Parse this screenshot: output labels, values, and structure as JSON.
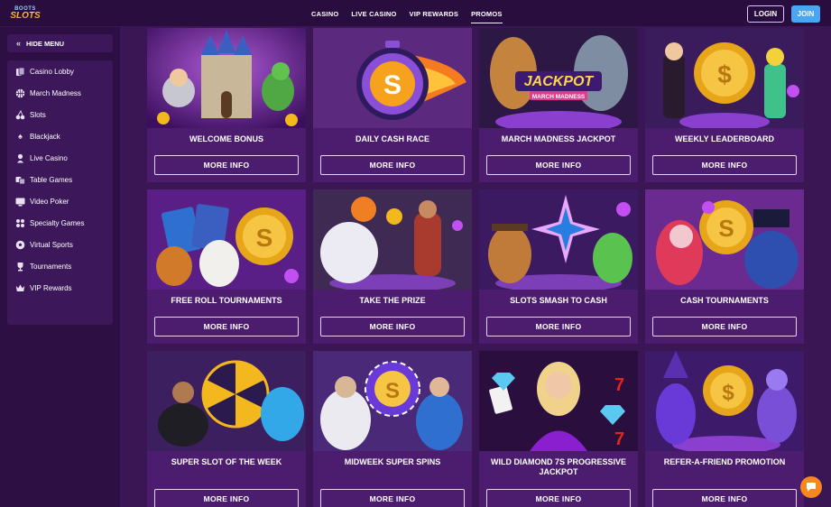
{
  "header": {
    "logo_top": "BOOTS",
    "logo_bottom": "SLOTS",
    "nav": [
      "CASINO",
      "LIVE CASINO",
      "VIP REWARDS",
      "PROMOS"
    ],
    "active_nav": "PROMOS",
    "login_label": "LOGIN",
    "join_label": "JOIN"
  },
  "sidebar": {
    "hide_menu_label": "HIDE MENU",
    "items": [
      {
        "label": "Casino Lobby",
        "icon": "cards-icon"
      },
      {
        "label": "March Madness",
        "icon": "basketball-icon"
      },
      {
        "label": "Slots",
        "icon": "cherries-icon"
      },
      {
        "label": "Blackjack",
        "icon": "spade-icon"
      },
      {
        "label": "Live Casino",
        "icon": "dealer-icon"
      },
      {
        "label": "Table Games",
        "icon": "dice-icon"
      },
      {
        "label": "Video Poker",
        "icon": "screen-icon"
      },
      {
        "label": "Specialty Games",
        "icon": "grid-icon"
      },
      {
        "label": "Virtual Sports",
        "icon": "soccer-ball-icon"
      },
      {
        "label": "Tournaments",
        "icon": "trophy-icon"
      },
      {
        "label": "VIP Rewards",
        "icon": "crown-icon"
      }
    ]
  },
  "promos": [
    {
      "title": "WELCOME BONUS",
      "button": "MORE INFO"
    },
    {
      "title": "DAILY CASH RACE",
      "button": "MORE INFO"
    },
    {
      "title": "MARCH MADNESS JACKPOT",
      "button": "MORE INFO",
      "image_text": "JACKPOT",
      "image_subtext": "MARCH MADNESS"
    },
    {
      "title": "WEEKLY LEADERBOARD",
      "button": "MORE INFO"
    },
    {
      "title": "FREE ROLL TOURNAMENTS",
      "button": "MORE INFO"
    },
    {
      "title": "TAKE THE PRIZE",
      "button": "MORE INFO"
    },
    {
      "title": "SLOTS SMASH TO CASH",
      "button": "MORE INFO"
    },
    {
      "title": "CASH TOURNAMENTS",
      "button": "MORE INFO"
    },
    {
      "title": "SUPER SLOT OF THE WEEK",
      "button": "MORE INFO"
    },
    {
      "title": "MIDWEEK SUPER SPINS",
      "button": "MORE INFO"
    },
    {
      "title": "WILD DIAMOND 7S PROGRESSIVE JACKPOT",
      "button": "MORE INFO"
    },
    {
      "title": "REFER-A-FRIEND PROMOTION",
      "button": "MORE INFO"
    }
  ],
  "colors": {
    "background": "#3a1654",
    "sidebar": "#2d0f43",
    "card": "#4c1d6e",
    "join": "#4aa6f2",
    "chat": "#f7871f"
  }
}
